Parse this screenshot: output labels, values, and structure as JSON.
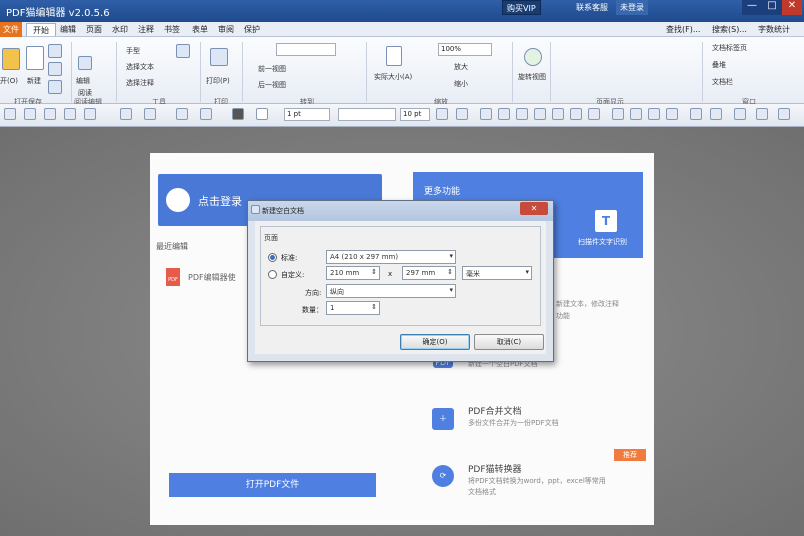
{
  "titlebar": {
    "title": "PDF猫编辑器 v2.0.5.6",
    "vip": "购买VIP",
    "service": "联系客服",
    "login": "未登录",
    "min": "—",
    "max": "□",
    "close": "✕"
  },
  "menubar": {
    "file": "文件",
    "items": [
      "开始",
      "编辑",
      "页面",
      "水印",
      "注释",
      "书签",
      "表单",
      "审阅",
      "保护"
    ],
    "right": [
      "查找(F)...",
      "搜索(S)...",
      "字数统计"
    ]
  },
  "ribbon": {
    "open": "开(O)",
    "new": "新建",
    "compile": "编辑",
    "read": "阅读",
    "hand": "手型",
    "select_text": "选择文本",
    "select_note": "选择注释",
    "print": "打印(P)",
    "prev_view": "前一视图",
    "next_view": "后一视图",
    "actual_size": "实际大小(A)",
    "zoom": "100%",
    "zoom_in": "放大",
    "zoom_out": "缩小",
    "rotate": "旋转视图",
    "doc_tabs": "文档标签页",
    "overlap": "叠堆",
    "tile": "文档栏",
    "groups": [
      "打开保存",
      "阅读编辑",
      "工具",
      "打印",
      "转到",
      "缩放",
      "页面显示",
      "窗口"
    ]
  },
  "quickbar": {
    "stroke": "1 pt",
    "font_size": "10 pt"
  },
  "home": {
    "login": "点击登录",
    "more": "更多功能",
    "ocr": "扫描件文字识别",
    "ocr_icon": "T",
    "recent": "最近编辑",
    "pdf_badge": "PDF",
    "recent_item": "PDF编辑器使",
    "open_btn": "打开PDF文件",
    "f_edit_desc1": "新建文本，修改注释",
    "f_edit_desc2": "功能",
    "f_create": "新建一个空白PDF文档",
    "f_merge_title": "PDF合并文档",
    "f_merge_desc": "多份文件合并为一份PDF文档",
    "f_convert_title": "PDF猫转换器",
    "f_convert_desc1": "将PDF文档转换为word，ppt，excel等常用",
    "f_convert_desc2": "文档格式",
    "recommend": "推荐"
  },
  "dialog": {
    "title": "新建空白文档",
    "close": "✕",
    "group": "页面",
    "standard": "标准:",
    "standard_value": "A4 (210 x 297 mm)",
    "custom": "自定义:",
    "width": "210 mm",
    "x": "x",
    "height": "297 mm",
    "unit": "毫米",
    "orientation_label": "方向:",
    "orientation": "纵向",
    "count_label": "数量：",
    "count": "1",
    "ok": "确定(O)",
    "cancel": "取消(C)"
  }
}
